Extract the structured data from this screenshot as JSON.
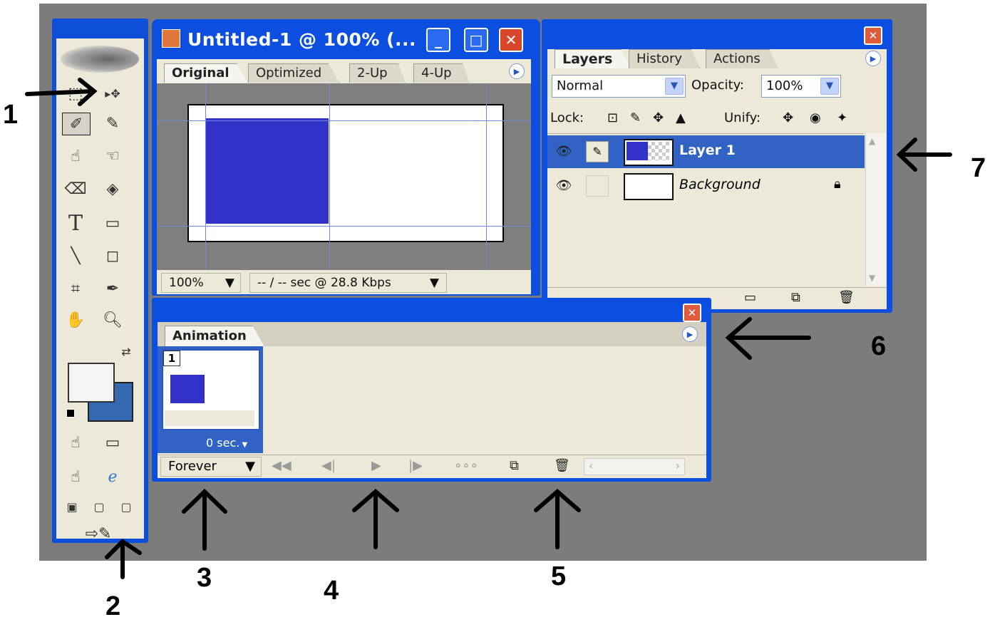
{
  "document_window": {
    "title": "Untitled-1 @ 100% (...",
    "tabs": [
      "Original",
      "Optimized",
      "2-Up",
      "4-Up"
    ],
    "zoom": "100%",
    "download_info": "-- / -- sec @ 28.8 Kbps"
  },
  "layers_panel": {
    "tabs": [
      "Layers",
      "History",
      "Actions"
    ],
    "blend_mode": "Normal",
    "opacity_label": "Opacity:",
    "opacity_value": "100%",
    "lock_label": "Lock:",
    "unify_label": "Unify:",
    "layers": [
      {
        "name": "Layer 1",
        "selected": true
      },
      {
        "name": "Background",
        "selected": false,
        "locked": true
      }
    ]
  },
  "animation_panel": {
    "tab": "Animation",
    "frame_number": "1",
    "frame_delay": "0 sec.",
    "loop": "Forever"
  },
  "annotations": [
    "1",
    "2",
    "3",
    "4",
    "5",
    "6",
    "7"
  ],
  "colors": {
    "titlebar": "#0c4fe0",
    "panel": "#ece9d8",
    "layer_fill": "#3232c8",
    "background_swatch": "#3468b0"
  }
}
